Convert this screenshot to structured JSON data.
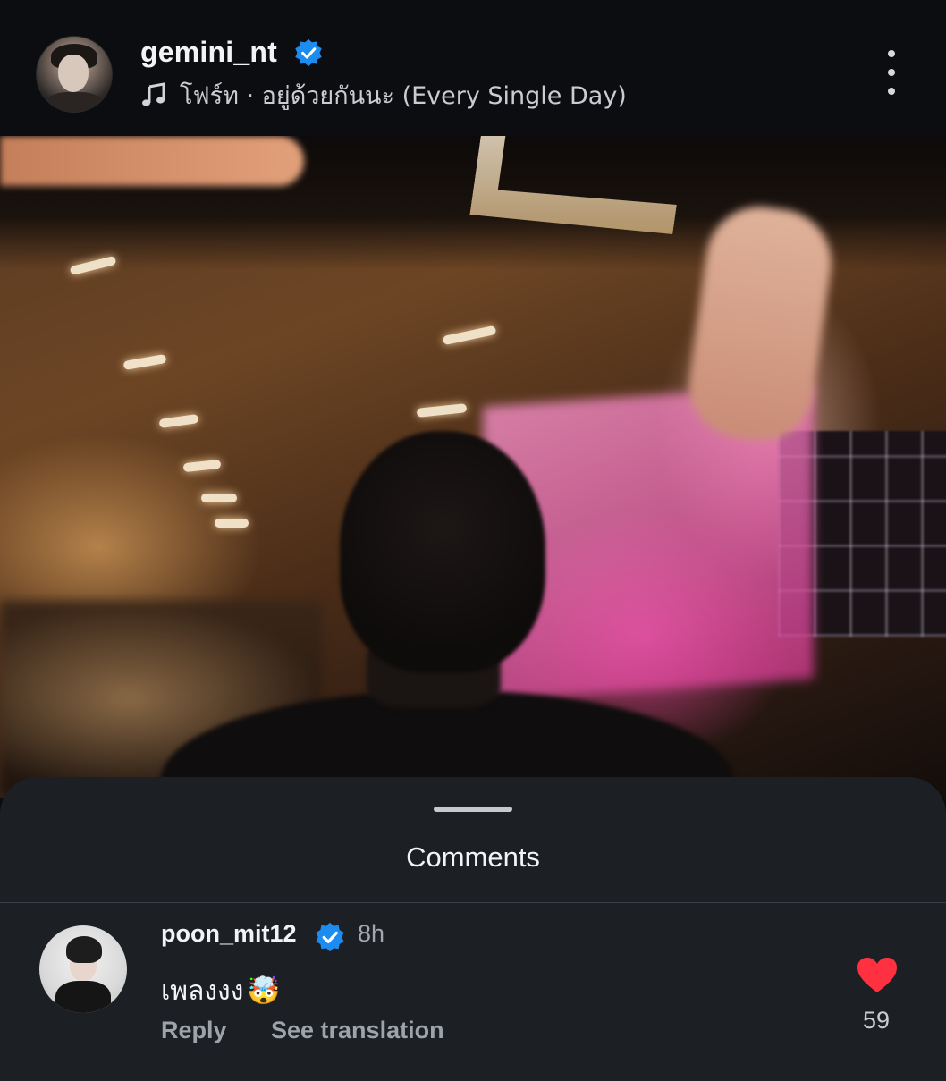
{
  "post": {
    "username": "gemini_nt",
    "music_label": "โฟร์ท · อยู่ด้วยกันนะ (Every Single Day)",
    "icons": {
      "verified": "verified-badge-icon",
      "music": "music-note-icon",
      "more": "more-vertical-icon"
    }
  },
  "comments_sheet": {
    "title": "Comments",
    "comments": [
      {
        "username": "poon_mit12",
        "time": "8h",
        "text": "เพลงงง",
        "emoji": "🤯",
        "reply_label": "Reply",
        "translate_label": "See translation",
        "like_count": "59"
      }
    ]
  },
  "colors": {
    "background": "#0b0d10",
    "sheet": "#1c2025",
    "verified": "#1d8cf0",
    "heart": "#ff3040"
  }
}
